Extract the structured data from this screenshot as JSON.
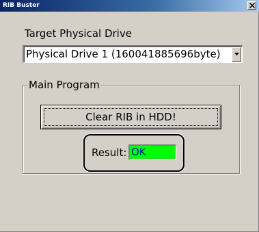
{
  "window": {
    "title": "RIB Buster"
  },
  "drive": {
    "label": "Target Physical Drive",
    "selected": "Physical Drive 1 (160041885696byte)"
  },
  "main_program": {
    "group_label": "Main Program",
    "clear_button_label": "Clear RIB in HDD!",
    "result_label": "Result:",
    "result_value": "OK",
    "result_color": "#00ff00"
  },
  "icons": {
    "close": "close-icon",
    "dropdown_arrow": "chevron-down-icon"
  }
}
